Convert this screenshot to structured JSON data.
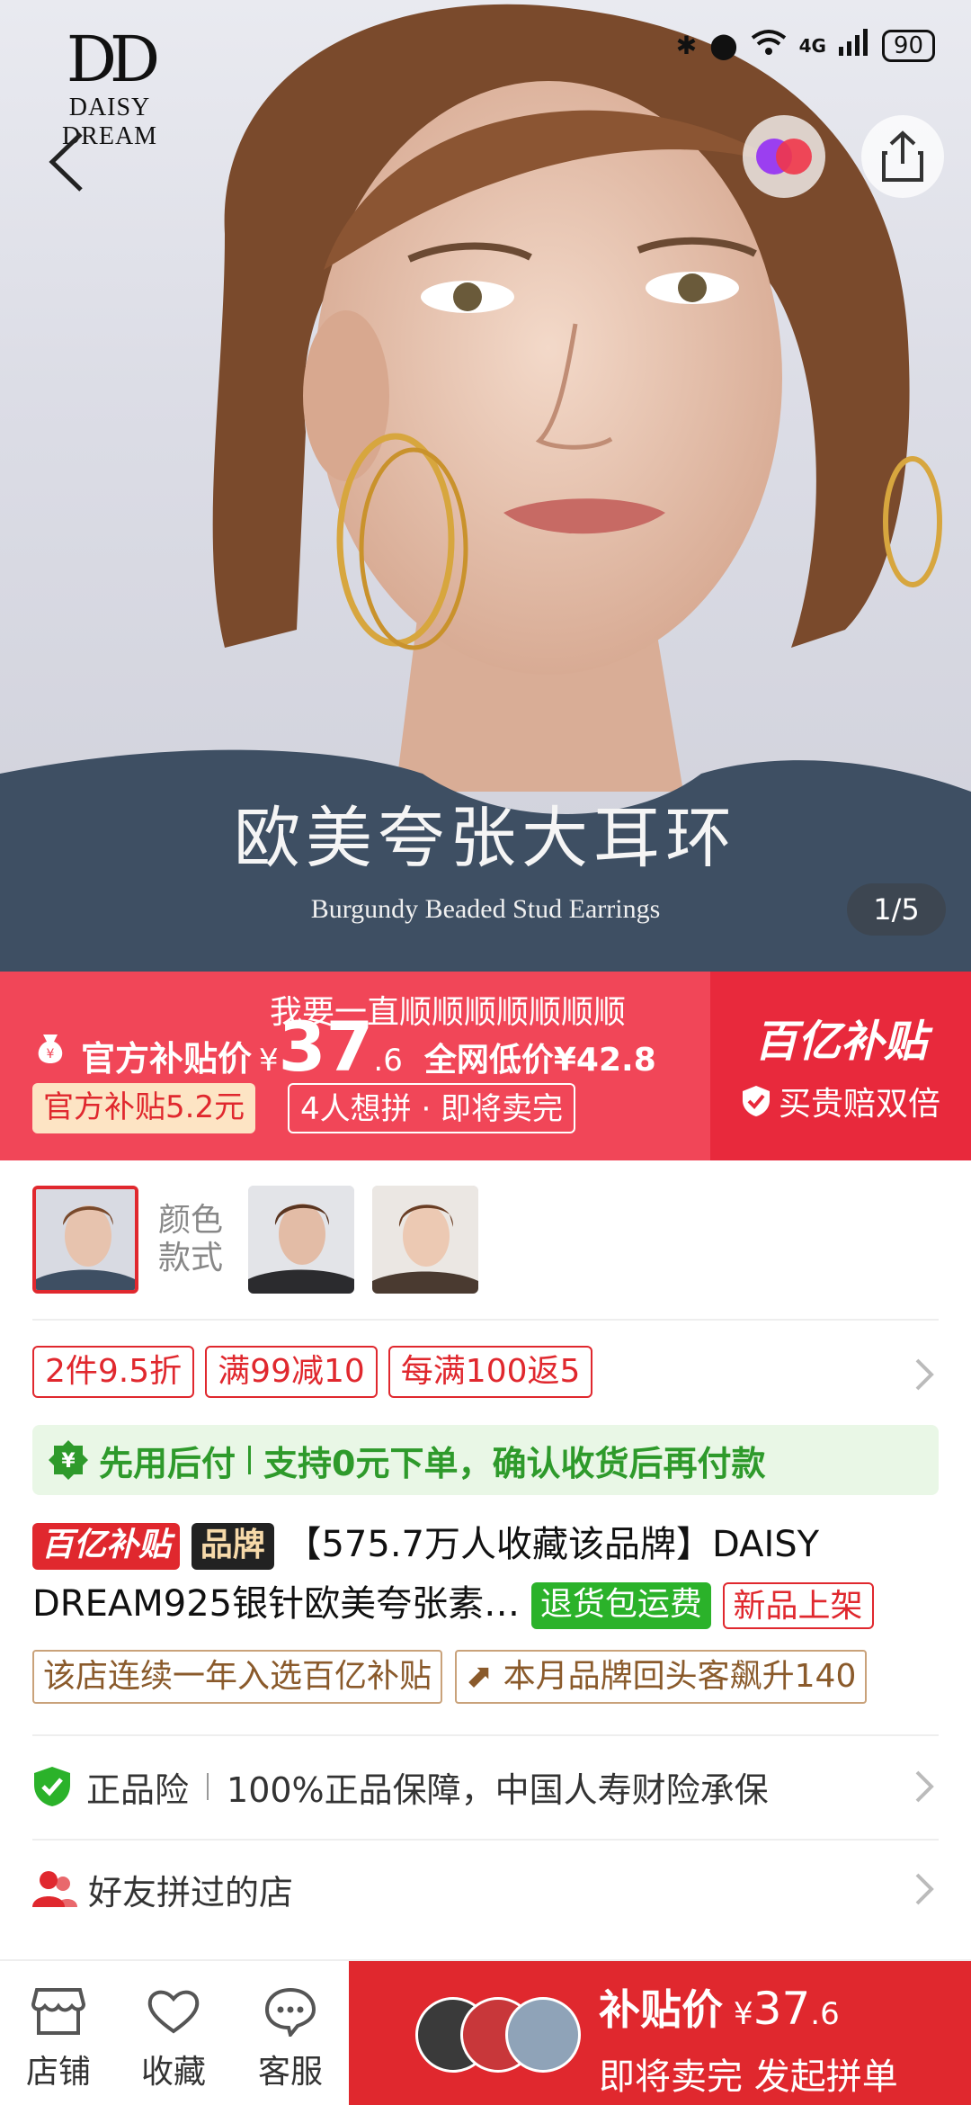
{
  "brand": {
    "mark": "DD",
    "name": "DAISY DREAM"
  },
  "status_bar": {
    "battery": "90",
    "network": "4G"
  },
  "hero": {
    "title": "欧美夸张大耳环",
    "subtitle": "Burgundy Beaded Stud Earrings",
    "counter": "1/5"
  },
  "price_banner": {
    "marquee": "我要一直顺顺顺顺顺顺顺",
    "label": "官方补贴价",
    "currency": "¥",
    "price_int": "37",
    "price_dec": ".6",
    "compare": "全网低价¥42.8",
    "subsidy_tag": "官方补贴5.2元",
    "group_tag": "4人想拼 · 即将卖完",
    "billion_title": "百亿补贴",
    "double_guarantee": "买贵赔双倍"
  },
  "variants": {
    "label_line1": "颜色",
    "label_line2": "款式"
  },
  "promos": [
    "2件9.5折",
    "满99减10",
    "每满100返5"
  ],
  "paylater": {
    "title": "先用后付",
    "text": "支持0元下单，确认收货后再付款"
  },
  "product": {
    "badge_billion": "百亿补贴",
    "badge_brand": "品牌",
    "title": "【575.7万人收藏该品牌】DAISY DREAM925银针欧美夸张素…",
    "badge_return": "退货包运费",
    "badge_new": "新品上架"
  },
  "honors": [
    "该店连续一年入选百亿补贴",
    "本月品牌回头客飙升140"
  ],
  "guarantee": {
    "title": "正品险",
    "text": "100%正品保障，中国人寿财险承保"
  },
  "friends": {
    "text": "好友拼过的店"
  },
  "bottom_nav": {
    "shop": "店铺",
    "favorite": "收藏",
    "service": "客服"
  },
  "cta": {
    "label": "补贴价",
    "currency": "¥",
    "price_int": "37",
    "price_dec": ".6",
    "sub": "即将卖完 发起拼单"
  },
  "colors": {
    "accent_red": "#e0282e",
    "banner_pink": "#f14658",
    "green": "#2e9a2b"
  }
}
